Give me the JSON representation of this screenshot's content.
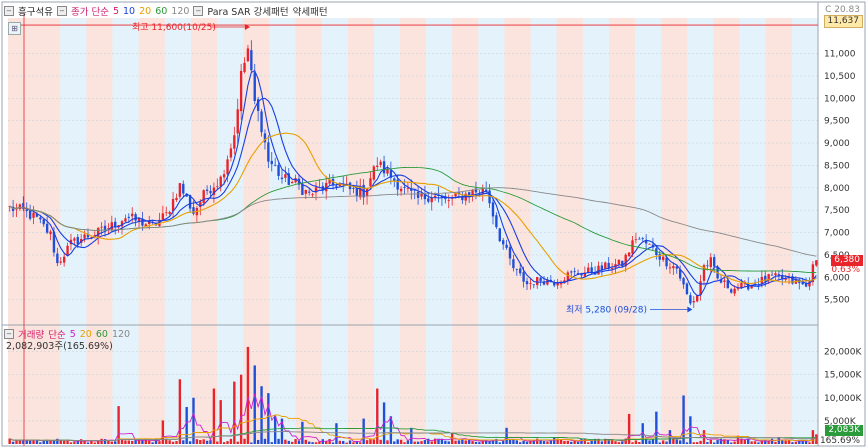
{
  "price_legend": {
    "stock_name": "흥구석유",
    "ma_label": "종가 단순",
    "periods": [
      {
        "label": "5",
        "color": "#1a3ee0"
      },
      {
        "label": "10",
        "color": "#1a3ee0"
      },
      {
        "label": "20",
        "color": "#e8a000"
      },
      {
        "label": "60",
        "color": "#2a9a3a"
      },
      {
        "label": "120",
        "color": "#888888"
      }
    ],
    "sar_label": "Para SAR 강세패턴",
    "weak_label": "약세패턴"
  },
  "volume_legend": {
    "title": "거래량",
    "ma_label": "단순",
    "periods": [
      {
        "label": "5",
        "color": "#cc22cc"
      },
      {
        "label": "20",
        "color": "#e8a000"
      },
      {
        "label": "60",
        "color": "#2a9a3a"
      },
      {
        "label": "120",
        "color": "#888888"
      }
    ],
    "value": "2,082,903주(165.69%)"
  },
  "annotations": {
    "high_label": "최고 11,600(10/25)",
    "low_label": "최저 5,280 (09/28)"
  },
  "right_tags": {
    "top_value": "11,637",
    "top_corner": "C 20.83",
    "current_price": "6,380",
    "change_pct": "0.63%",
    "volume_now": "2,083K",
    "volume_pct": "165.69%"
  },
  "chart_data": [
    {
      "type": "candlestick",
      "title": "",
      "y_ticks": [
        5500,
        6000,
        6500,
        7000,
        7500,
        8000,
        8500,
        9000,
        9500,
        10000,
        10500,
        11000
      ],
      "ylim": [
        5000,
        11750
      ],
      "phase_bands": [
        "red",
        "red",
        "blue",
        "red",
        "blue",
        "red",
        "blue",
        "red",
        "blue",
        "red",
        "blue",
        "red",
        "blue",
        "red",
        "blue",
        "red",
        "blue",
        "red",
        "blue",
        "red",
        "blue",
        "red",
        "blue",
        "red",
        "blue",
        "red",
        "blue",
        "red",
        "blue",
        "red",
        "blue"
      ],
      "anchors": [
        [
          0,
          7550
        ],
        [
          4,
          7480
        ],
        [
          8,
          7300
        ],
        [
          12,
          6950
        ],
        [
          14,
          6300
        ],
        [
          18,
          6750
        ],
        [
          22,
          6900
        ],
        [
          26,
          7000
        ],
        [
          30,
          7150
        ],
        [
          34,
          7350
        ],
        [
          38,
          7250
        ],
        [
          42,
          7150
        ],
        [
          46,
          7400
        ],
        [
          50,
          8050
        ],
        [
          54,
          7450
        ],
        [
          58,
          7950
        ],
        [
          62,
          8200
        ],
        [
          66,
          9200
        ],
        [
          68,
          10500
        ],
        [
          70,
          11100
        ],
        [
          72,
          9900
        ],
        [
          74,
          9400
        ],
        [
          76,
          8600
        ],
        [
          78,
          8450
        ],
        [
          80,
          8200
        ],
        [
          84,
          8100
        ],
        [
          88,
          7850
        ],
        [
          92,
          8000
        ],
        [
          96,
          8100
        ],
        [
          100,
          7950
        ],
        [
          104,
          7900
        ],
        [
          108,
          8550
        ],
        [
          112,
          8250
        ],
        [
          116,
          7950
        ],
        [
          120,
          7750
        ],
        [
          124,
          7850
        ],
        [
          128,
          7700
        ],
        [
          132,
          7800
        ],
        [
          136,
          7900
        ],
        [
          140,
          7950
        ],
        [
          144,
          6900
        ],
        [
          148,
          6200
        ],
        [
          152,
          5850
        ],
        [
          156,
          5950
        ],
        [
          160,
          5900
        ],
        [
          164,
          6050
        ],
        [
          168,
          6100
        ],
        [
          172,
          6150
        ],
        [
          176,
          6250
        ],
        [
          180,
          6300
        ],
        [
          184,
          6900
        ],
        [
          188,
          6700
        ],
        [
          192,
          6400
        ],
        [
          196,
          6200
        ],
        [
          198,
          5800
        ],
        [
          200,
          5400
        ],
        [
          202,
          5600
        ],
        [
          204,
          6250
        ],
        [
          206,
          6350
        ],
        [
          208,
          5950
        ],
        [
          212,
          5750
        ],
        [
          216,
          5800
        ],
        [
          220,
          5900
        ],
        [
          224,
          6000
        ],
        [
          228,
          5950
        ],
        [
          232,
          5850
        ],
        [
          234,
          5780
        ],
        [
          236,
          6200
        ],
        [
          237,
          6380
        ]
      ],
      "ma": [
        {
          "period": 5,
          "color": "#1a3ee0"
        },
        {
          "period": 10,
          "color": "#1a3ee0"
        },
        {
          "period": 20,
          "color": "#e8a000"
        },
        {
          "period": 60,
          "color": "#2a9a3a"
        },
        {
          "period": 120,
          "color": "#888888"
        }
      ],
      "high": {
        "value": 11600,
        "date": "10/25"
      },
      "low": {
        "value": 5280,
        "date": "09/28"
      }
    },
    {
      "type": "bar",
      "title": "",
      "y_ticks": [
        5000,
        10000,
        15000,
        20000
      ],
      "tick_labels": [
        "5,000K",
        "10,000K",
        "15,000K",
        "20,000K"
      ],
      "ylim": [
        0,
        22500
      ],
      "spikes": [
        [
          32,
          8200
        ],
        [
          45,
          5100
        ],
        [
          50,
          14000
        ],
        [
          52,
          8000
        ],
        [
          54,
          10000
        ],
        [
          60,
          12000
        ],
        [
          62,
          9500
        ],
        [
          66,
          13500
        ],
        [
          68,
          15000
        ],
        [
          70,
          21000
        ],
        [
          72,
          17000
        ],
        [
          74,
          12500
        ],
        [
          76,
          11000
        ],
        [
          78,
          6000
        ],
        [
          80,
          5500
        ],
        [
          86,
          4800
        ],
        [
          96,
          4500
        ],
        [
          104,
          5500
        ],
        [
          108,
          12000
        ],
        [
          110,
          9000
        ],
        [
          112,
          6000
        ],
        [
          118,
          3500
        ],
        [
          130,
          2500
        ],
        [
          146,
          3500
        ],
        [
          160,
          1500
        ],
        [
          182,
          6500
        ],
        [
          186,
          4500
        ],
        [
          190,
          7000
        ],
        [
          194,
          3000
        ],
        [
          198,
          10500
        ],
        [
          200,
          6000
        ],
        [
          204,
          3000
        ],
        [
          214,
          1800
        ],
        [
          226,
          1500
        ],
        [
          236,
          3000
        ],
        [
          237,
          2083
        ]
      ],
      "ma": [
        {
          "period": 5,
          "color": "#cc22cc"
        },
        {
          "period": 20,
          "color": "#e8a000"
        },
        {
          "period": 60,
          "color": "#2a9a3a"
        },
        {
          "period": 120,
          "color": "#888888"
        }
      ]
    }
  ]
}
